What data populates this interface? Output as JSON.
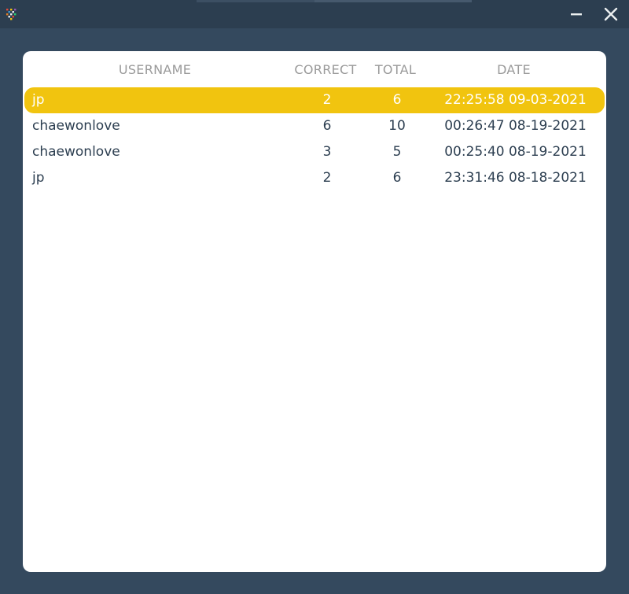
{
  "colors": {
    "background": "#34495e",
    "titlebar": "#2c3e50",
    "panel": "#ffffff",
    "selected_row": "#f1c40f",
    "text": "#2c3e50",
    "header_text": "#9a9a9a"
  },
  "titlebar": {
    "icon": "app-grid-icon",
    "minimize_icon": "minimize-icon",
    "close_icon": "close-icon"
  },
  "table": {
    "columns": [
      "USERNAME",
      "CORRECT",
      "TOTAL",
      "DATE"
    ],
    "rows": [
      {
        "username": "jp",
        "correct": "2",
        "total": "6",
        "date": "22:25:58 09-03-2021",
        "selected": true
      },
      {
        "username": "chaewonlove",
        "correct": "6",
        "total": "10",
        "date": "00:26:47 08-19-2021",
        "selected": false
      },
      {
        "username": "chaewonlove",
        "correct": "3",
        "total": "5",
        "date": "00:25:40 08-19-2021",
        "selected": false
      },
      {
        "username": "jp",
        "correct": "2",
        "total": "6",
        "date": "23:31:46 08-18-2021",
        "selected": false
      }
    ]
  }
}
